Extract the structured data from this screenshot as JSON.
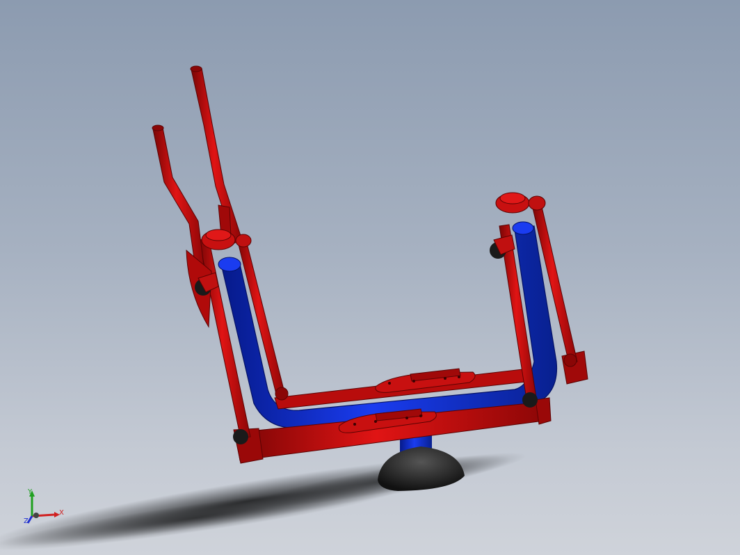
{
  "viewport": {
    "background_top": "#8c9bb0",
    "background_bottom": "#cfd3da"
  },
  "model": {
    "frame_color": "#c40c0c",
    "frame_shadow_color": "#7a0505",
    "tube_color": "#0d2fd6",
    "tube_shadow_color": "#061a8a",
    "base_color": "#2a2a2a",
    "cap_color": "#1a1a1a"
  },
  "triad": {
    "x_label": "X",
    "y_label": "Y",
    "z_label": "Z",
    "x_color": "#d02020",
    "y_color": "#20a020",
    "z_color": "#2030d0"
  }
}
